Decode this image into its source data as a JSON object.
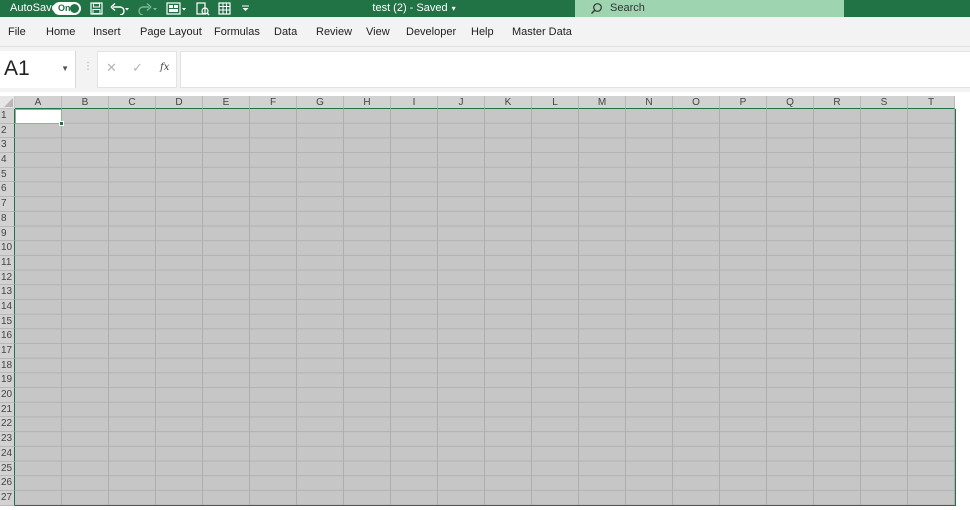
{
  "titlebar": {
    "autosave_label": "AutoSave",
    "autosave_state": "On",
    "document_title": "test (2)  -  Saved",
    "search_placeholder": "Search",
    "quick_access_icons": [
      "save-icon",
      "undo-icon",
      "redo-icon",
      "form-icon",
      "print-preview-icon",
      "table-icon",
      "customize-caret-icon"
    ]
  },
  "ribbon": {
    "tabs": [
      {
        "label": "File"
      },
      {
        "label": "Home"
      },
      {
        "label": "Insert"
      },
      {
        "label": "Page Layout"
      },
      {
        "label": "Formulas"
      },
      {
        "label": "Data"
      },
      {
        "label": "Review"
      },
      {
        "label": "View"
      },
      {
        "label": "Developer"
      },
      {
        "label": "Help"
      },
      {
        "label": "Master Data"
      }
    ]
  },
  "formula_bar": {
    "name_box": "A1",
    "cancel_symbol": "✕",
    "enter_symbol": "✓",
    "function_symbol": "fx",
    "value": ""
  },
  "sheet": {
    "columns": [
      "A",
      "B",
      "C",
      "D",
      "E",
      "F",
      "G",
      "H",
      "I",
      "J",
      "K",
      "L",
      "M",
      "N",
      "O",
      "P",
      "Q",
      "R",
      "S",
      "T"
    ],
    "rows": [
      "1",
      "2",
      "3",
      "4",
      "5",
      "6",
      "7",
      "8",
      "9",
      "10",
      "11",
      "12",
      "13",
      "14",
      "15",
      "16",
      "17",
      "18",
      "19",
      "20",
      "21",
      "22",
      "23",
      "24",
      "25",
      "26",
      "27"
    ],
    "active_cell": "A1"
  },
  "colors": {
    "accent": "#217346",
    "search_bg": "#9fd4b1",
    "selection_fill": "#c6c6c6"
  }
}
